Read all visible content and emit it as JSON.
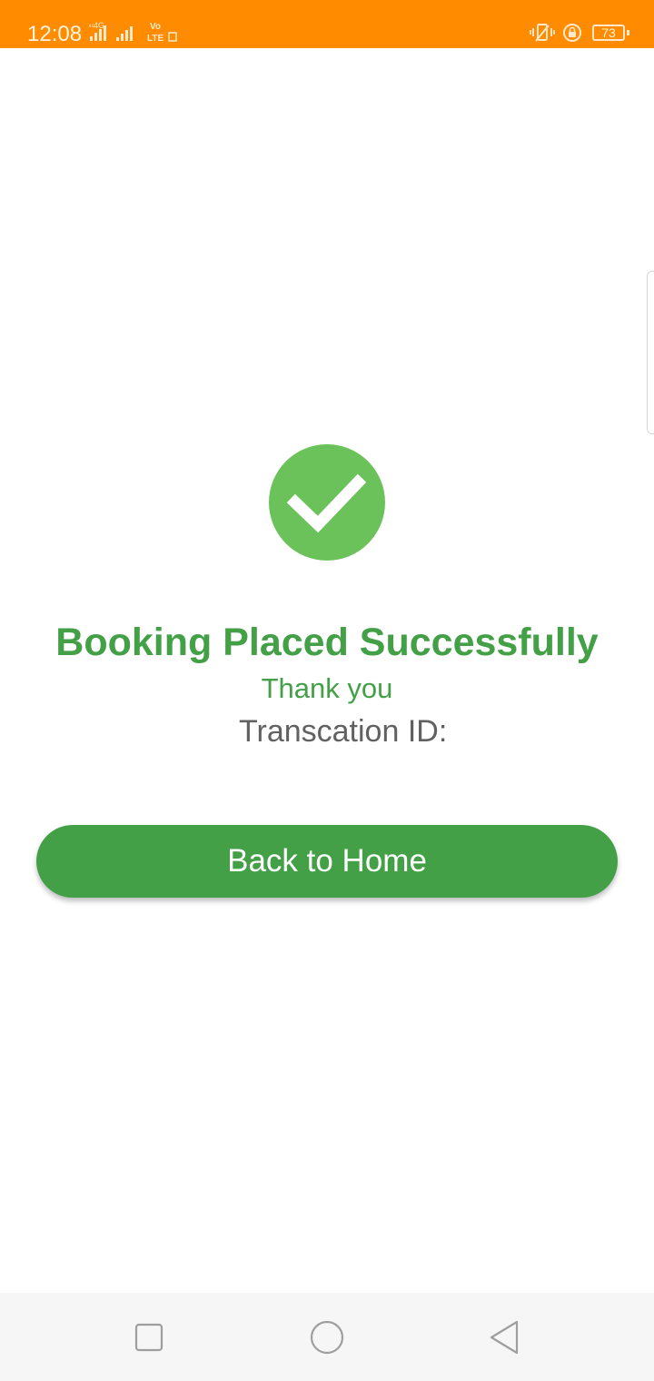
{
  "status_bar": {
    "time": "12:08",
    "battery_level": "73",
    "background_color": "#ff8c00",
    "left_icons": [
      "network-4g-icon",
      "signal-strength-icon",
      "signal-strength-icon",
      "volte-icon"
    ],
    "right_icons": [
      "vibrate-icon",
      "rotation-lock-icon",
      "battery-icon"
    ]
  },
  "main": {
    "icon": "check-circle-icon",
    "icon_color": "#6cc25a",
    "title": "Booking Placed Successfully",
    "subtitle": "Thank you",
    "transaction_label": "Transcation ID:",
    "button_label": "Back to Home",
    "accent_color": "#43a047"
  },
  "nav_bar": {
    "buttons": [
      "recent-apps-icon",
      "home-icon",
      "back-icon"
    ]
  }
}
